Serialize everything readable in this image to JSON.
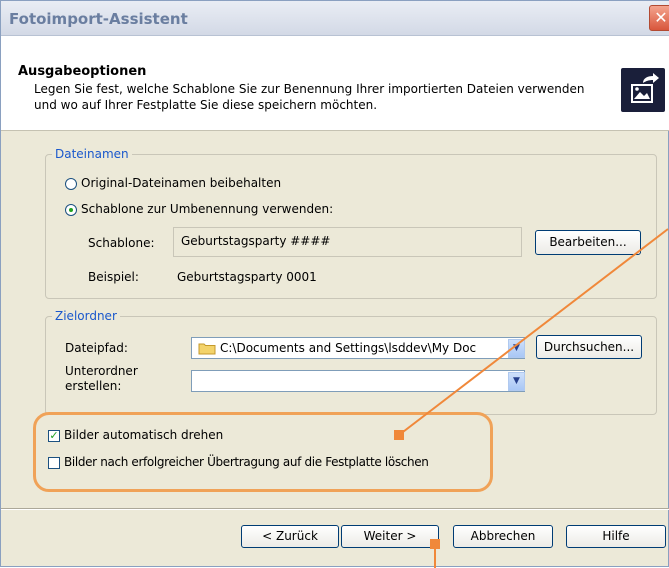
{
  "window": {
    "title": "Fotoimport-Assistent",
    "close_glyph": "✕"
  },
  "header": {
    "title": "Ausgabeoptionen",
    "description": "Legen Sie fest, welche Schablone Sie zur Benennung Ihrer importierten Dateien verwenden und wo auf Ihrer Festplatte Sie diese speichern möchten.",
    "icon": "photo-export-icon"
  },
  "dateinamen": {
    "legend": "Dateinamen",
    "option_original": "Original-Dateinamen beibehalten",
    "option_template": "Schablone zur Umbenennung verwenden:",
    "selected": "template",
    "template_label": "Schablone:",
    "template_value": "Geburtstagsparty ####",
    "edit_button": "Bearbeiten...",
    "example_label": "Beispiel:",
    "example_value": "Geburtstagsparty 0001"
  },
  "zielordner": {
    "legend": "Zielordner",
    "path_label": "Dateipfad:",
    "path_value": "C:\\Documents and Settings\\lsddev\\My Doc",
    "browse_button": "Durchsuchen...",
    "subfolder_label_1": "Unterordner",
    "subfolder_label_2": "erstellen:",
    "subfolder_value": ""
  },
  "options": {
    "rotate_label": "Bilder automatisch drehen",
    "rotate_checked": true,
    "delete_label": "Bilder nach erfolgreicher Übertragung auf die Festplatte löschen",
    "delete_checked": false
  },
  "footer": {
    "back": "< Zurück",
    "next": "Weiter >",
    "cancel": "Abbrechen",
    "help": "Hilfe"
  },
  "colors": {
    "annotation": "#f0883a",
    "legend": "#1a58cc",
    "checkmark": "#21a121"
  }
}
